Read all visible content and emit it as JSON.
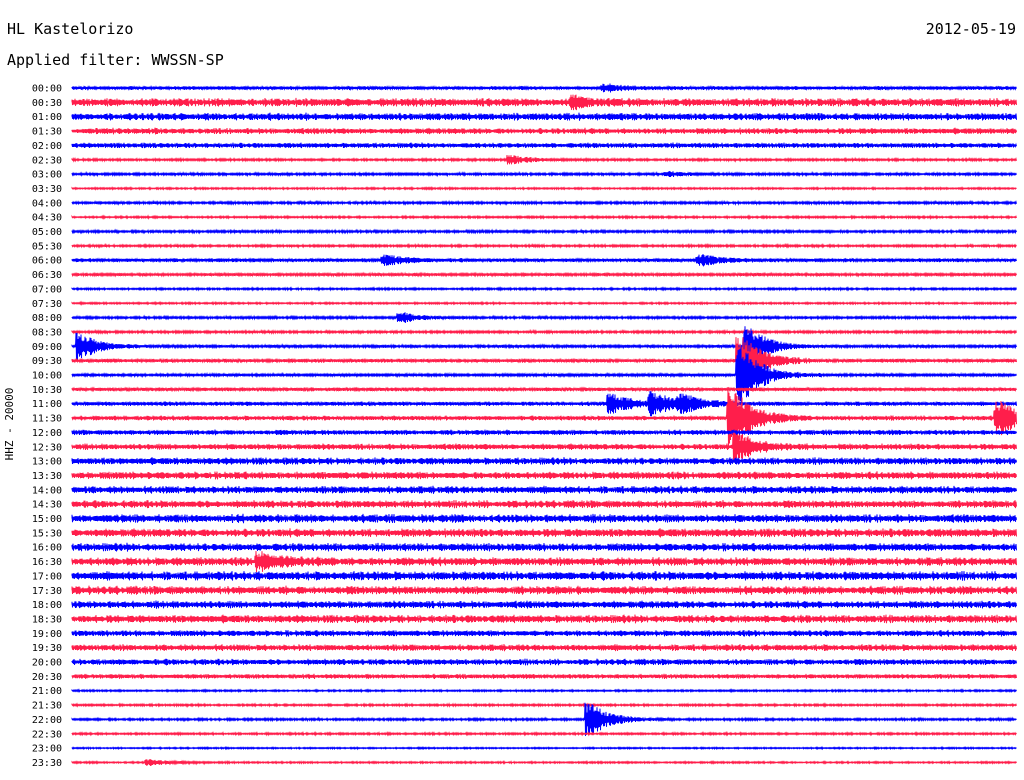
{
  "header": {
    "station": "HL Kastelorizo",
    "date": "2012-05-19",
    "filter_text": "Applied filter: WWSSN-SP"
  },
  "colors": {
    "odd_trace": "#0000ff",
    "even_trace": "#ff1e4b",
    "text": "#000000",
    "background": "#ffffff"
  },
  "chart_data": {
    "type": "line",
    "title": "",
    "ylabel": "HHZ - 20000",
    "xlabel": "",
    "grid": false,
    "rows": [
      "00:00",
      "00:30",
      "01:00",
      "01:30",
      "02:00",
      "02:30",
      "03:00",
      "03:30",
      "04:00",
      "04:30",
      "05:00",
      "05:30",
      "06:00",
      "06:30",
      "07:00",
      "07:30",
      "08:00",
      "08:30",
      "09:00",
      "09:30",
      "10:00",
      "10:30",
      "11:00",
      "11:30",
      "12:00",
      "12:30",
      "13:00",
      "13:30",
      "14:00",
      "14:30",
      "15:00",
      "15:30",
      "16:00",
      "16:30",
      "17:00",
      "17:30",
      "18:00",
      "18:30",
      "19:00",
      "19:30",
      "20:00",
      "20:30",
      "21:00",
      "21:30",
      "22:00",
      "22:30",
      "23:00",
      "23:30"
    ],
    "noise_level": [
      1.6,
      3.5,
      3.2,
      2.6,
      2.2,
      0.9,
      1.0,
      0.7,
      1.0,
      0.8,
      1.0,
      0.9,
      1.6,
      1.2,
      0.8,
      0.7,
      1.0,
      1.0,
      1.2,
      1.6,
      1.2,
      1.6,
      1.8,
      2.0,
      2.2,
      2.6,
      3.0,
      3.2,
      3.2,
      3.2,
      3.6,
      3.6,
      3.4,
      3.6,
      3.8,
      3.6,
      3.2,
      3.4,
      2.6,
      2.8,
      2.6,
      2.0,
      0.7,
      0.8,
      0.9,
      0.8,
      0.6,
      0.7
    ],
    "events": [
      {
        "row": "00:00",
        "minute": 17.0,
        "amplitude": 3
      },
      {
        "row": "00:30",
        "minute": 16.0,
        "amplitude": 4
      },
      {
        "row": "02:30",
        "minute": 14.0,
        "amplitude": 4
      },
      {
        "row": "03:00",
        "minute": 19.0,
        "amplitude": 2
      },
      {
        "row": "06:00",
        "minute": 10.0,
        "amplitude": 5
      },
      {
        "row": "06:00",
        "minute": 20.0,
        "amplitude": 5
      },
      {
        "row": "08:00",
        "minute": 10.5,
        "amplitude": 5
      },
      {
        "row": "09:00",
        "minute": 0.3,
        "amplitude": 12
      },
      {
        "row": "09:00",
        "minute": 21.5,
        "amplitude": 20
      },
      {
        "row": "09:30",
        "minute": 21.3,
        "amplitude": 26
      },
      {
        "row": "10:00",
        "minute": 21.3,
        "amplitude": 30
      },
      {
        "row": "11:00",
        "minute": 17.2,
        "amplitude": 9
      },
      {
        "row": "11:00",
        "minute": 18.5,
        "amplitude": 10
      },
      {
        "row": "11:00",
        "minute": 19.4,
        "amplitude": 8
      },
      {
        "row": "11:30",
        "minute": 21.0,
        "amplitude": 30
      },
      {
        "row": "11:30",
        "minute": 29.5,
        "amplitude": 16
      },
      {
        "row": "12:30",
        "minute": 21.2,
        "amplitude": 12
      },
      {
        "row": "16:30",
        "minute": 6.0,
        "amplitude": 8
      },
      {
        "row": "22:00",
        "minute": 16.5,
        "amplitude": 16
      },
      {
        "row": "23:30",
        "minute": 2.5,
        "amplitude": 3
      }
    ]
  }
}
